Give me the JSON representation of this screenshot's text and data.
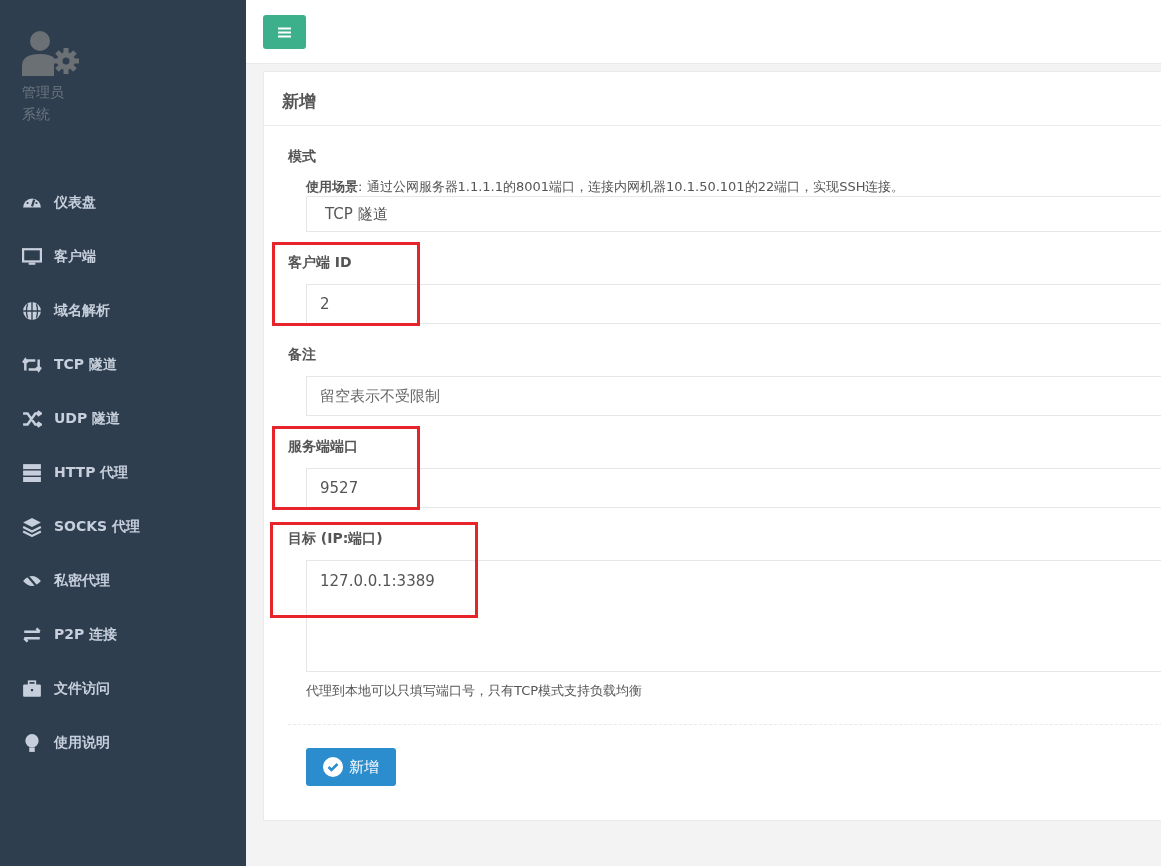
{
  "sidebar": {
    "user": {
      "name": "管理员",
      "role": "系统"
    },
    "items": [
      {
        "label": "仪表盘"
      },
      {
        "label": "客户端"
      },
      {
        "label": "域名解析"
      },
      {
        "label": "TCP 隧道"
      },
      {
        "label": "UDP 隧道"
      },
      {
        "label": "HTTP 代理"
      },
      {
        "label": "SOCKS 代理"
      },
      {
        "label": "私密代理"
      },
      {
        "label": "P2P 连接"
      },
      {
        "label": "文件访问"
      },
      {
        "label": "使用说明"
      }
    ]
  },
  "card": {
    "title": "新增",
    "fields": [
      {
        "kind": "select",
        "label": "模式",
        "hint": "**使用场景**: 通过公网服务器1.1.1.1的8001端口，连接内网机器10.1.50.101的22端口，实现SSH连接。",
        "value": "TCP 隧道",
        "highlighted": false
      },
      {
        "kind": "input",
        "label": "客户端 ID",
        "value": "2",
        "highlighted": true
      },
      {
        "kind": "input",
        "label": "备注",
        "placeholder": "留空表示不受限制",
        "highlighted": false
      },
      {
        "kind": "input",
        "label": "服务端端口",
        "value": "9527",
        "highlighted": true
      },
      {
        "kind": "textarea",
        "label": "目标 (IP:端口)",
        "value": "127.0.0.1:3389",
        "help": "代理到本地可以只填写端口号，只有TCP模式支持负载均衡",
        "highlighted": true
      }
    ],
    "submit": "新增"
  }
}
